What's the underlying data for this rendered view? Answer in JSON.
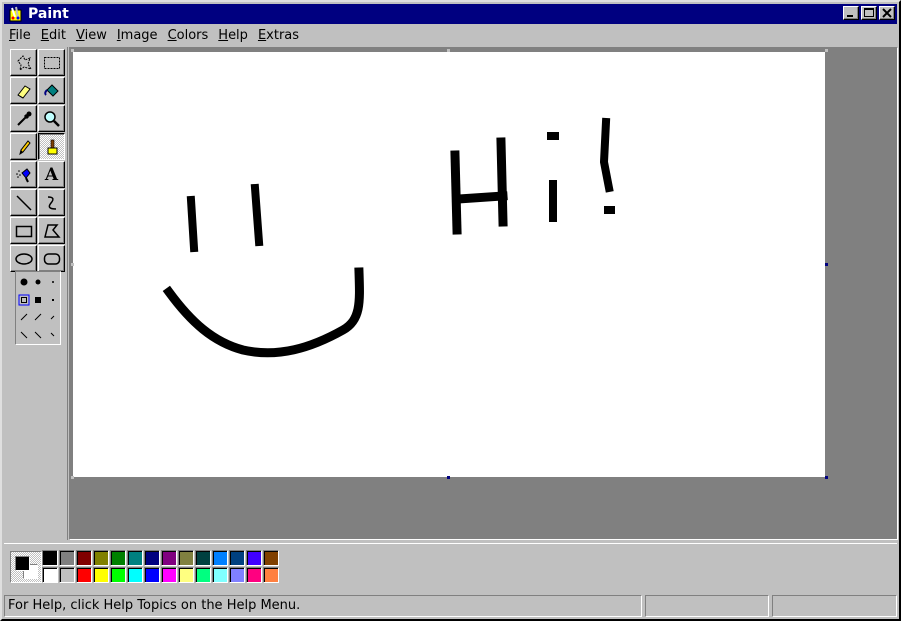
{
  "window": {
    "title": "Paint",
    "app_icon": "paint-palette-icon",
    "buttons": [
      "minimize-icon",
      "maximize-icon",
      "close-icon"
    ]
  },
  "menu": [
    {
      "accel": "F",
      "rest": "ile"
    },
    {
      "accel": "E",
      "rest": "dit"
    },
    {
      "accel": "V",
      "rest": "iew"
    },
    {
      "accel": "I",
      "rest": "mage"
    },
    {
      "accel": "C",
      "rest": "olors"
    },
    {
      "accel": "H",
      "rest": "elp"
    },
    {
      "accel": "E",
      "rest": "xtras"
    }
  ],
  "tools": [
    {
      "name": "free-form-select-icon"
    },
    {
      "name": "rectangle-select-icon"
    },
    {
      "name": "eraser-icon"
    },
    {
      "name": "fill-bucket-icon"
    },
    {
      "name": "color-picker-icon"
    },
    {
      "name": "magnifier-icon"
    },
    {
      "name": "pencil-icon"
    },
    {
      "name": "brush-icon",
      "active": true
    },
    {
      "name": "airbrush-icon"
    },
    {
      "name": "text-icon",
      "label": "A"
    },
    {
      "name": "line-icon"
    },
    {
      "name": "curve-icon"
    },
    {
      "name": "rectangle-icon"
    },
    {
      "name": "polygon-icon"
    },
    {
      "name": "ellipse-icon"
    },
    {
      "name": "rounded-rectangle-icon"
    }
  ],
  "canvas": {
    "drawing_text": "Hi!",
    "drawing_desc": "smiley face"
  },
  "colors": {
    "foreground": "#000000",
    "background": "#ffffff",
    "palette": [
      "#000000",
      "#808080",
      "#800000",
      "#808000",
      "#008000",
      "#008080",
      "#000080",
      "#800080",
      "#808040",
      "#004040",
      "#0080ff",
      "#004080",
      "#4000ff",
      "#804000",
      "#ffffff",
      "#c0c0c0",
      "#ff0000",
      "#ffff00",
      "#00ff00",
      "#00ffff",
      "#0000ff",
      "#ff00ff",
      "#ffff80",
      "#00ff80",
      "#80ffff",
      "#8080ff",
      "#ff0080",
      "#ff8040"
    ]
  },
  "status": {
    "help_text": "For Help, click Help Topics on the Help Menu.",
    "coords": "",
    "size": ""
  }
}
